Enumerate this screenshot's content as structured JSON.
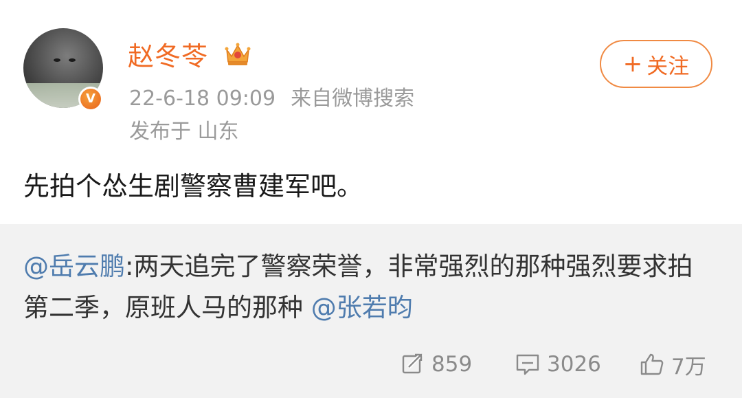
{
  "post": {
    "username": "赵冬苓",
    "date": "22-6-18 09:09",
    "source": "来自微博搜索",
    "location": "发布于 山东",
    "follow_plus": "+",
    "follow_label": "关注",
    "verify_badge": "V",
    "content": "先拍个怂生剧警察曹建军吧。"
  },
  "retweet": {
    "mention_author": "@岳云鹏",
    "text_part1": ":两天追完了警察荣誉，非常强烈的那种强烈要求拍第二季，原班人马的那种",
    "mention_tail": "@张若昀"
  },
  "actions": {
    "repost_count": "859",
    "comment_count": "3026",
    "like_count": "7万"
  },
  "colors": {
    "username": "#f06a23",
    "mention": "#4f7cae",
    "retweet_bg": "#f2f2f2",
    "meta": "#9a9a9a"
  },
  "icons": {
    "crown": "crown-icon",
    "verify": "verified-badge-icon",
    "repost": "repost-icon",
    "comment": "comment-icon",
    "like": "thumbs-up-icon"
  }
}
